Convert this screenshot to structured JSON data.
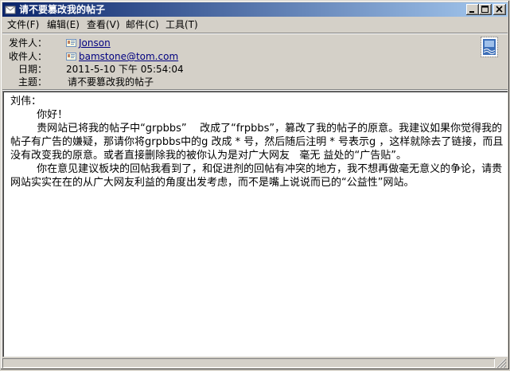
{
  "window": {
    "title": "请不要篡改我的帖子"
  },
  "menu": [
    {
      "label": "文件(F)"
    },
    {
      "label": "编辑(E)"
    },
    {
      "label": "查看(V)"
    },
    {
      "label": "邮件(C)"
    },
    {
      "label": "工具(T)"
    }
  ],
  "header": {
    "from_label": "发件人：",
    "from_value": "Jonson",
    "to_label": "收件人：",
    "to_value": "bamstone@tom.com",
    "date_label": "日期：",
    "date_value": "2011-5-10 下午 05:54:04",
    "subject_label": "主题：",
    "subject_value": "请不要篡改我的帖子"
  },
  "message": {
    "body": "刘伟：\n        你好！\n        贵网站已将我的帖子中“grpbbs”    改成了“frpbbs”，篡改了我的帖子的原意。我建议如果你觉得我的帖子有广告的嫌疑，那请你将grpbbs中的g 改成 * 号，然后随后注明 * 号表示g ，这样就除去了链接，而且没有改变我的原意。或者直接删除我的被你认为是对广大网友   毫无 益处的“广告贴”。\n        你在意见建议板块的回帖我看到了，和促进剂的回帖有冲突的地方，我不想再做毫无意义的争论，请贵网站实实在在的从广大网友利益的角度出发考虑，而不是嘴上说说而已的“公益性”网站。"
  },
  "colors": {
    "title_start": "#0a246a",
    "title_end": "#a6caf0",
    "chrome": "#d4d0c8",
    "link": "#000080"
  },
  "icons": [
    "envelope-icon",
    "minimize-icon",
    "maximize-icon",
    "close-icon",
    "contact-card-icon",
    "stamp-icon",
    "resize-grip-icon"
  ]
}
